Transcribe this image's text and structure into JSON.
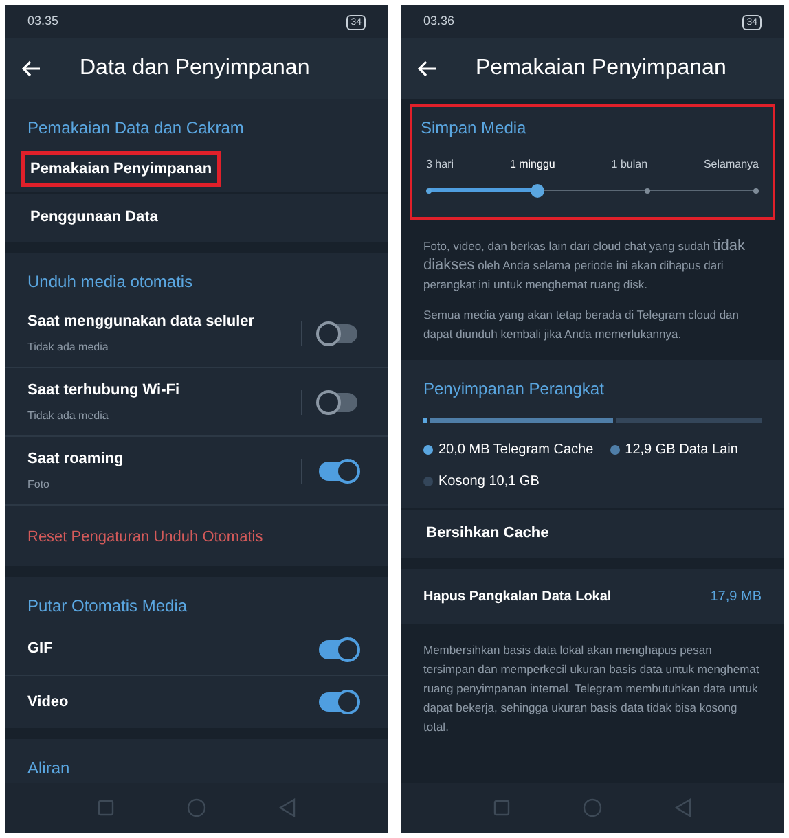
{
  "phones": [
    {
      "status_bar": {
        "time": "03.35",
        "battery": "34"
      },
      "header": {
        "title": "Data dan Penyimpanan"
      },
      "sections": [
        {
          "title": "Pemakaian Data dan Cakram",
          "items": [
            {
              "kind": "link",
              "label": "Pemakaian Penyimpanan",
              "highlighted": true
            },
            {
              "kind": "link",
              "label": "Penggunaan Data",
              "highlighted": false
            }
          ]
        },
        {
          "title": "Unduh media otomatis",
          "items": [
            {
              "kind": "toggle",
              "label": "Saat menggunakan data seluler",
              "subtitle": "Tidak ada media",
              "on": false
            },
            {
              "kind": "toggle",
              "label": "Saat terhubung Wi-Fi",
              "subtitle": "Tidak ada media",
              "on": false
            },
            {
              "kind": "toggle",
              "label": "Saat roaming",
              "subtitle": "Foto",
              "on": true
            },
            {
              "kind": "danger",
              "label": "Reset Pengaturan Unduh Otomatis"
            }
          ]
        },
        {
          "title": "Putar Otomatis Media",
          "items": [
            {
              "kind": "switch",
              "label": "GIF",
              "on": true
            },
            {
              "kind": "switch",
              "label": "Video",
              "on": true
            }
          ]
        },
        {
          "title": "Aliran"
        }
      ]
    },
    {
      "status_bar": {
        "time": "03.36",
        "battery": "34"
      },
      "header": {
        "title": "Pemakaian Penyimpanan"
      },
      "sections": [
        {
          "title": "Simpan Media",
          "highlighted": true,
          "items": [
            {
              "kind": "slider",
              "level": 0.333,
              "options": [
                {
                  "label": "3 hari",
                  "selected": false
                },
                {
                  "label": "1 minggu",
                  "selected": true
                },
                {
                  "label": "1 bulan",
                  "selected": false
                },
                {
                  "label": "Selamanya",
                  "selected": false
                }
              ]
            }
          ],
          "notes": [
            "Foto, video, dan berkas lain dari cloud chat yang sudah **tidak diakses** oleh Anda selama periode ini akan dihapus dari perangkat ini untuk menghemat ruang disk.",
            "Semua media yang akan tetap berada di Telegram cloud dan dapat diunduh kembali jika Anda memerlukannya."
          ]
        },
        {
          "title": "Penyimpanan Perangkat",
          "items": [
            {
              "kind": "storage",
              "segments": [
                {
                  "label": "20,0 MB Telegram Cache",
                  "color": "#5aa6e0",
                  "level": 0.01
                },
                {
                  "label": "12,9 GB Data Lain",
                  "color": "#4f7ea8",
                  "level": 0.55
                },
                {
                  "label": "Kosong 10,1 GB",
                  "color": "#34465a",
                  "level": 0.44
                }
              ]
            },
            {
              "kind": "link",
              "label": "Bersihkan Cache",
              "highlighted": false
            }
          ]
        },
        {
          "items": [
            {
              "kind": "value",
              "label": "Hapus Pangkalan Data Lokal",
              "value": "17,9 MB"
            }
          ],
          "notes": [
            "Membersihkan basis data lokal akan menghapus pesan tersimpan dan memperkecil ukuran basis data untuk menghemat ruang penyimpanan internal. Telegram membutuhkan data untuk dapat bekerja, sehingga ukuran basis data tidak bisa kosong total."
          ]
        }
      ]
    }
  ]
}
